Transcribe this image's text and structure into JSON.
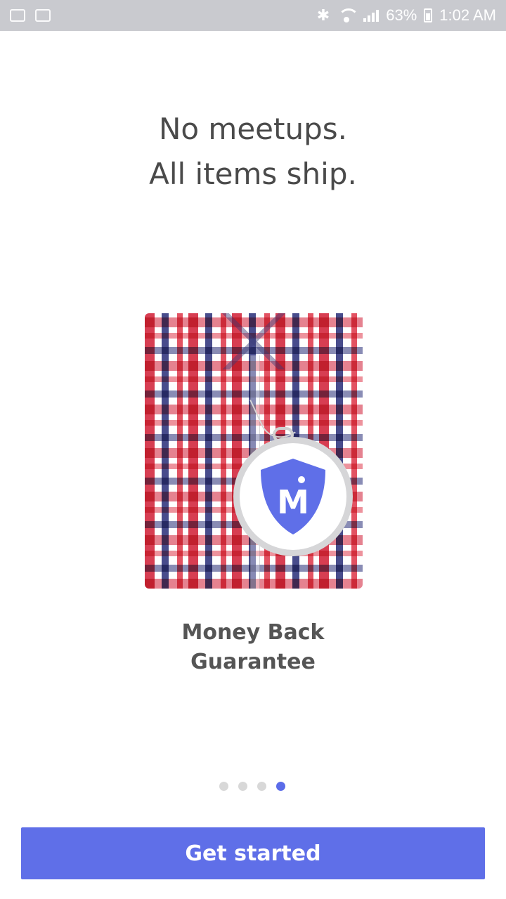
{
  "status_bar": {
    "battery_percent": "63%",
    "time": "1:02 AM"
  },
  "onboarding": {
    "headline_line1": "No meetups.",
    "headline_line2": "All items ship.",
    "caption_line1": "Money Back",
    "caption_line2": "Guarantee",
    "badge_letter": "M",
    "page_count": 4,
    "active_page": 4
  },
  "cta": {
    "label": "Get started"
  },
  "colors": {
    "accent": "#5f6fe8",
    "text": "#4a4a4a",
    "status_bar_bg": "#c9cacf"
  }
}
